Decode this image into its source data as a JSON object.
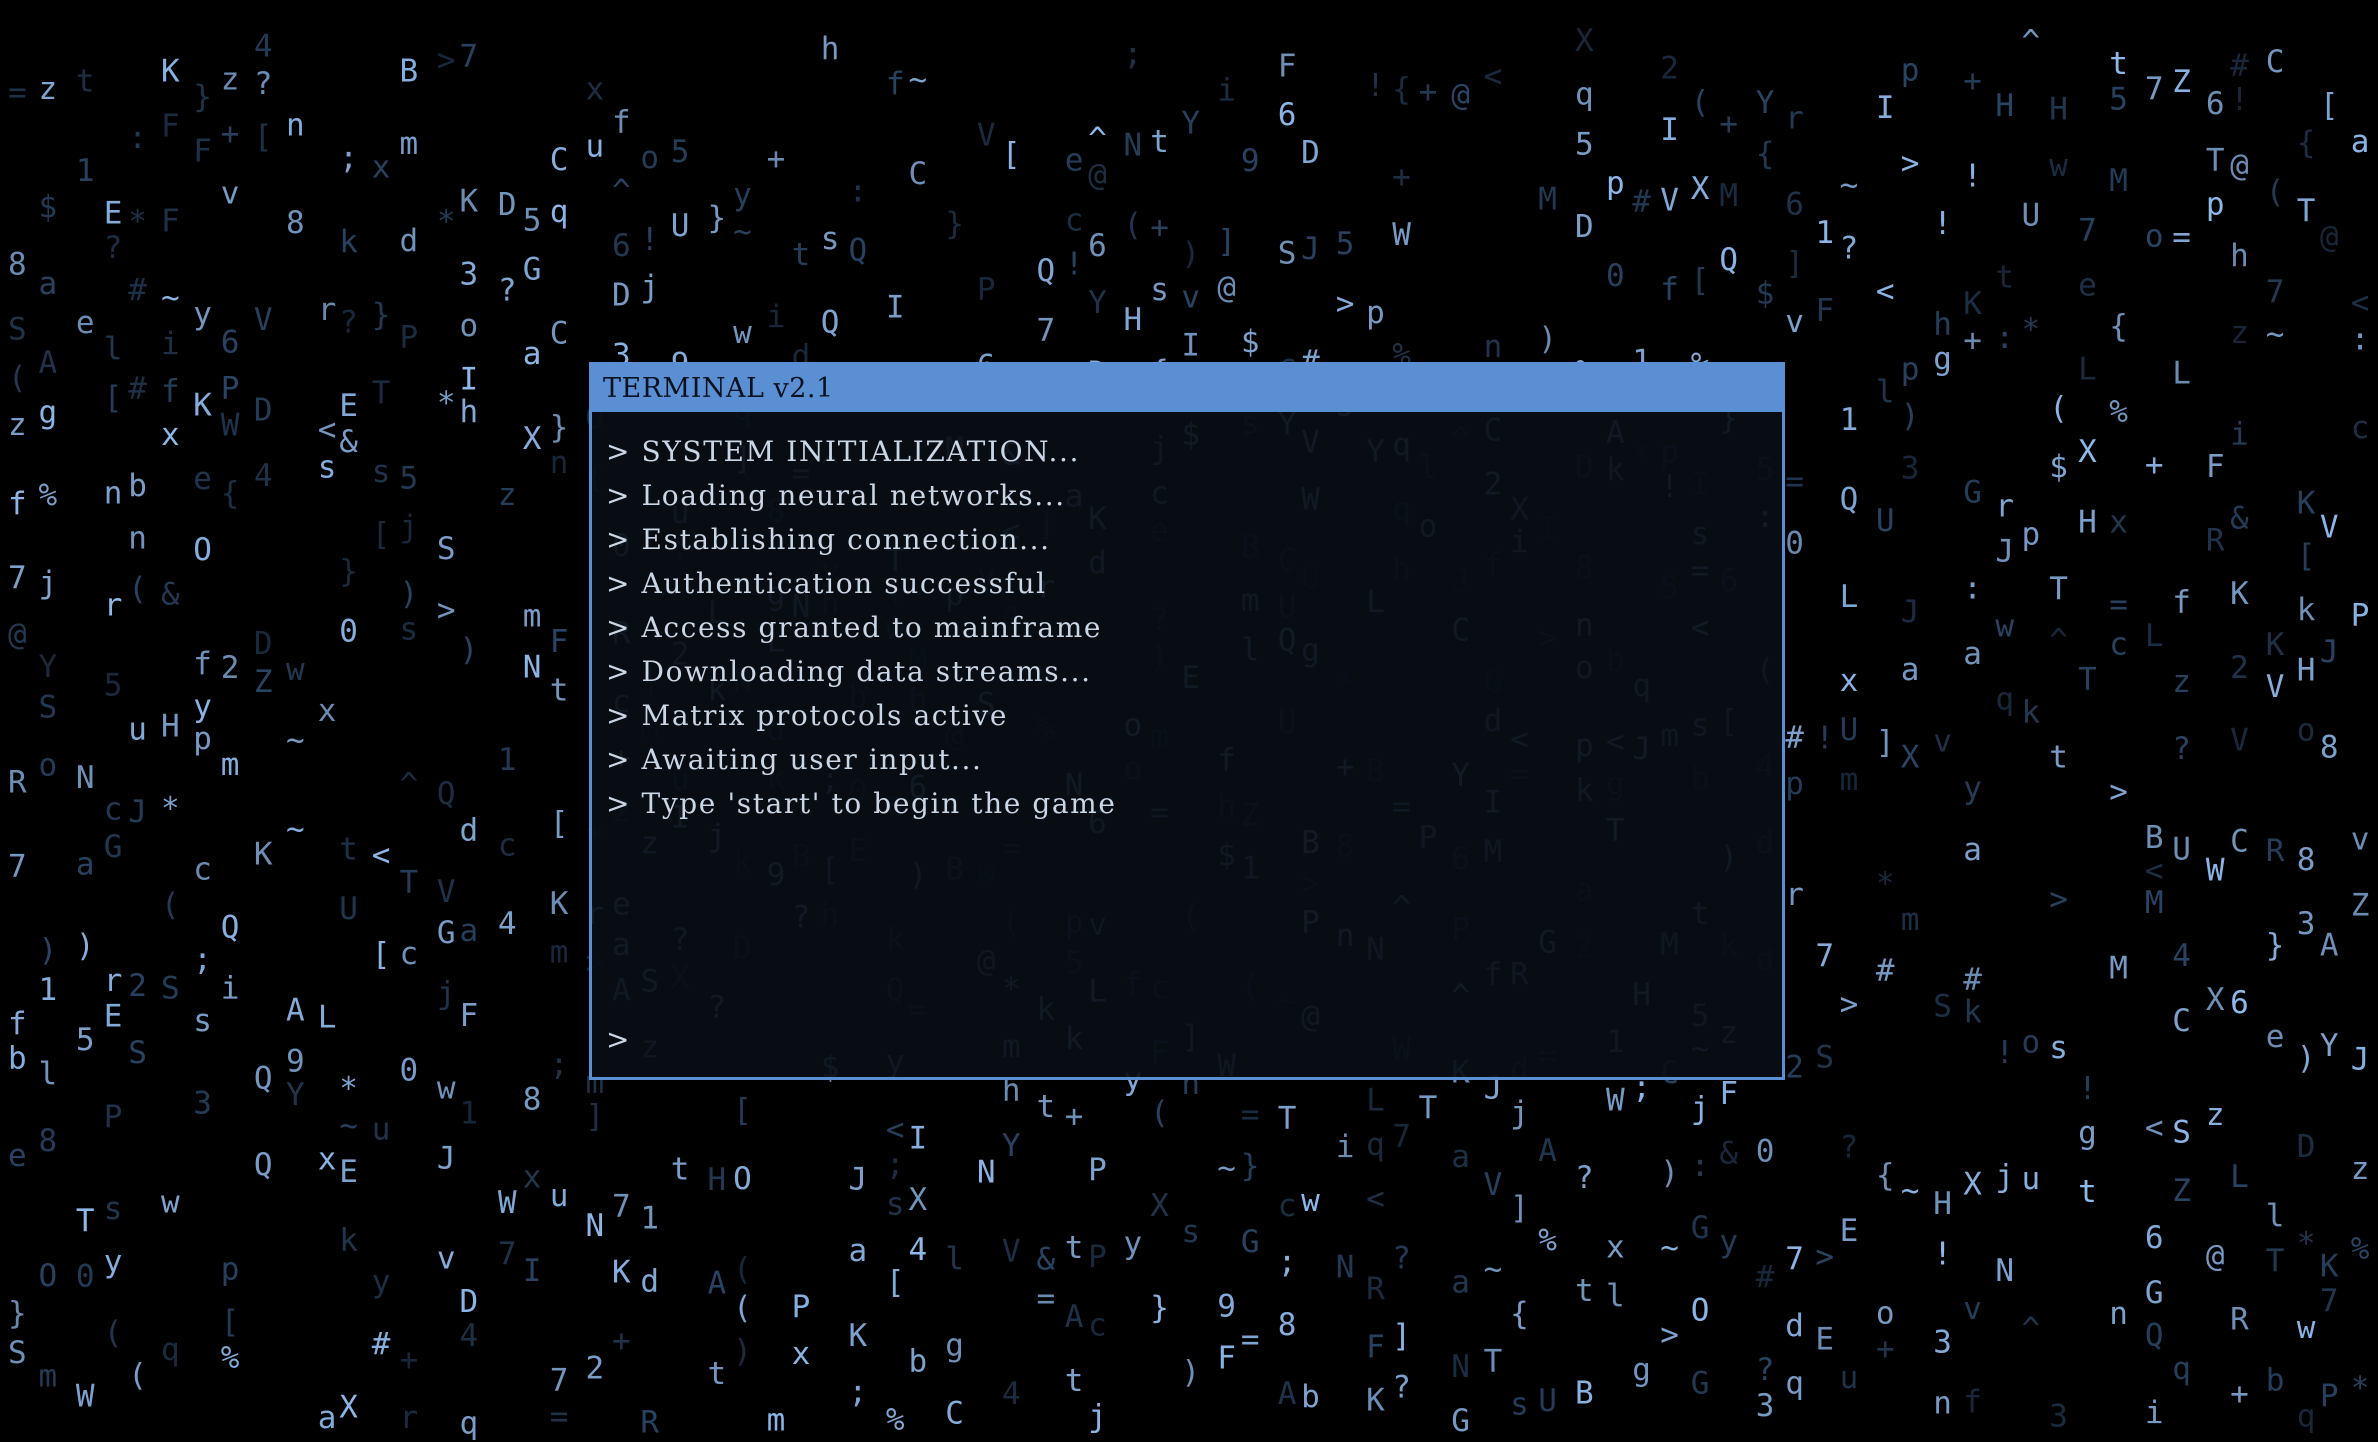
{
  "terminal": {
    "title": "TERMINAL v2.1",
    "lines": [
      "> SYSTEM INITIALIZATION...",
      "> Loading neural networks...",
      "> Establishing connection...",
      "> Authentication successful",
      "> Access granted to mainframe",
      "> Downloading data streams...",
      "> Matrix protocols active",
      "> Awaiting user input...",
      "> Type 'start' to begin the game"
    ],
    "prompt": ">",
    "input_value": ""
  },
  "colors": {
    "background": "#000000",
    "accent": "#5b8fd4",
    "rain_bright": "#8db8ea",
    "rain_dim": "#2e4d70",
    "terminal_text": "#c9d6e6"
  }
}
